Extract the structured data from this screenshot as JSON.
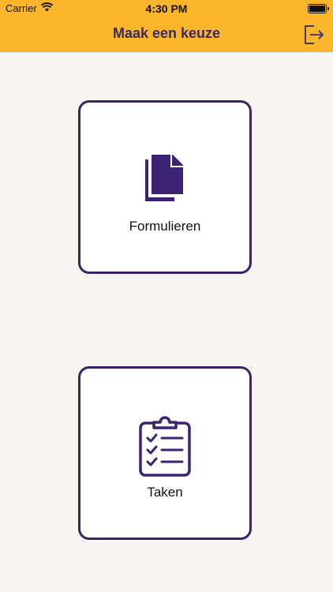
{
  "status_bar": {
    "carrier": "Carrier",
    "time": "4:30 PM"
  },
  "header": {
    "title": "Maak een keuze",
    "logout_icon": "logout-icon"
  },
  "tiles": [
    {
      "label": "Formulieren",
      "icon": "documents-icon"
    },
    {
      "label": "Taken",
      "icon": "clipboard-checklist-icon"
    }
  ],
  "colors": {
    "header": "#fbb52a",
    "accent": "#3a2366",
    "background": "#f6f5f1"
  }
}
